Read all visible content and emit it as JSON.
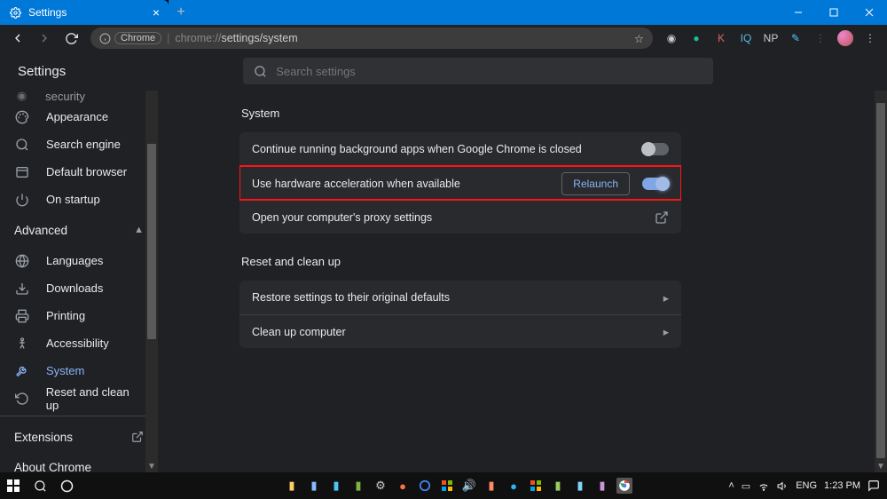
{
  "window": {
    "tab_title": "Settings",
    "new_tab_tooltip": "New tab"
  },
  "addressbar": {
    "chip": "Chrome",
    "url_prefix": "chrome://",
    "url_path": "settings/system"
  },
  "page": {
    "title": "Settings",
    "search_placeholder": "Search settings"
  },
  "sidebar": {
    "top_items": [
      {
        "icon": "shield-icon",
        "label": "Privacy and security"
      },
      {
        "icon": "paint-icon",
        "label": "Appearance"
      },
      {
        "icon": "search-icon",
        "label": "Search engine"
      },
      {
        "icon": "browser-icon",
        "label": "Default browser"
      },
      {
        "icon": "power-icon",
        "label": "On startup"
      }
    ],
    "advanced_label": "Advanced",
    "adv_items": [
      {
        "icon": "globe-icon",
        "label": "Languages"
      },
      {
        "icon": "download-icon",
        "label": "Downloads"
      },
      {
        "icon": "print-icon",
        "label": "Printing"
      },
      {
        "icon": "accessibility-icon",
        "label": "Accessibility"
      },
      {
        "icon": "wrench-icon",
        "label": "System",
        "active": true
      },
      {
        "icon": "restore-icon",
        "label": "Reset and clean up"
      }
    ],
    "extensions_label": "Extensions",
    "about_label": "About Chrome"
  },
  "system": {
    "section_title": "System",
    "rows": {
      "bg_apps": "Continue running background apps when Google Chrome is closed",
      "hw_accel": "Use hardware acceleration when available",
      "relaunch": "Relaunch",
      "proxy": "Open your computer's proxy settings"
    }
  },
  "reset": {
    "section_title": "Reset and clean up",
    "rows": {
      "restore": "Restore settings to their original defaults",
      "cleanup": "Clean up computer"
    }
  },
  "taskbar": {
    "lang": "ENG",
    "time": "1:23 PM"
  },
  "ext_labels": {
    "k": "K",
    "iq": "IQ",
    "np": "NP"
  }
}
